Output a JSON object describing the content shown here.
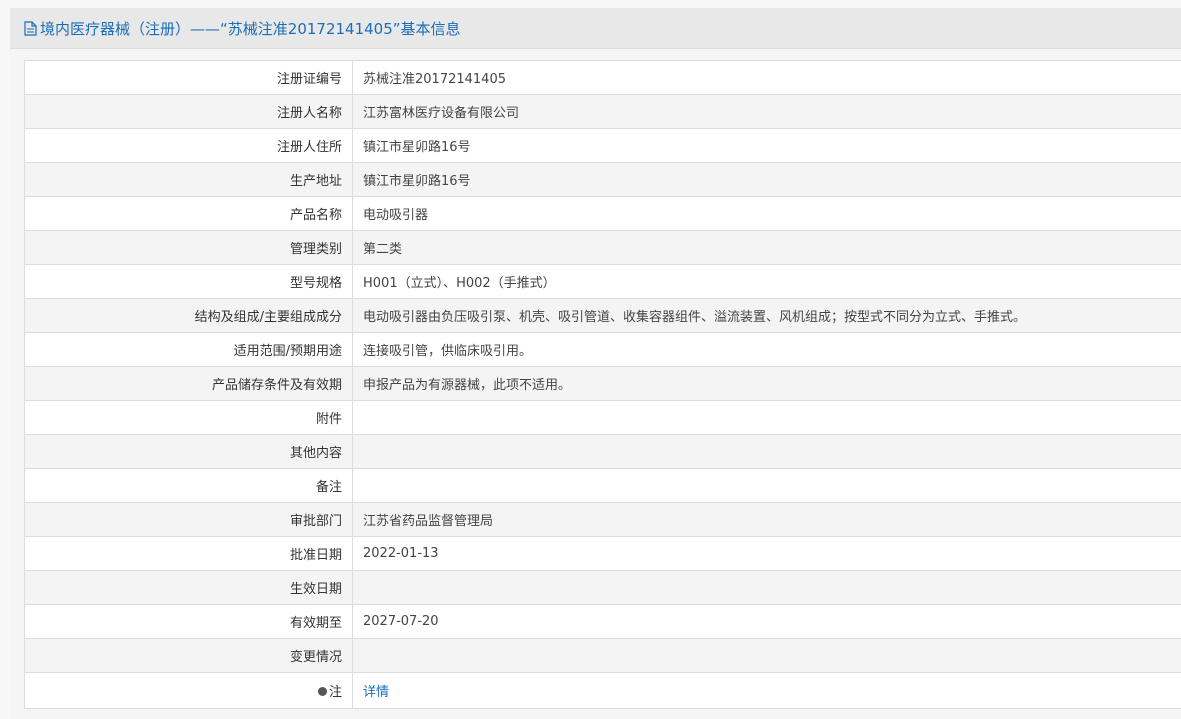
{
  "header": {
    "title": "境内医疗器械（注册）——“苏械注准20172141405”基本信息",
    "icon": "document-icon"
  },
  "rows": [
    {
      "label": "注册证编号",
      "value": "苏械注准20172141405"
    },
    {
      "label": "注册人名称",
      "value": "江苏富林医疗设备有限公司"
    },
    {
      "label": "注册人住所",
      "value": "镇江市星卯路16号"
    },
    {
      "label": "生产地址",
      "value": "镇江市星卯路16号"
    },
    {
      "label": "产品名称",
      "value": "电动吸引器"
    },
    {
      "label": "管理类别",
      "value": "第二类"
    },
    {
      "label": "型号规格",
      "value": "H001（立式）、H002（手推式）"
    },
    {
      "label": "结构及组成/主要组成成分",
      "value": "电动吸引器由负压吸引泵、机壳、吸引管道、收集容器组件、溢流装置、风机组成；按型式不同分为立式、手推式。"
    },
    {
      "label": "适用范围/预期用途",
      "value": "连接吸引管，供临床吸引用。"
    },
    {
      "label": "产品储存条件及有效期",
      "value": "申报产品为有源器械，此项不适用。"
    },
    {
      "label": "附件",
      "value": ""
    },
    {
      "label": "其他内容",
      "value": ""
    },
    {
      "label": "备注",
      "value": ""
    },
    {
      "label": "审批部门",
      "value": "江苏省药品监督管理局"
    },
    {
      "label": "批准日期",
      "value": "2022-01-13"
    },
    {
      "label": "生效日期",
      "value": ""
    },
    {
      "label": "有效期至",
      "value": "2027-07-20"
    },
    {
      "label": "变更情况",
      "value": ""
    }
  ],
  "note": {
    "label": "注",
    "icon": "pin-icon",
    "link_text": "详情"
  },
  "colors": {
    "accent": "#1b6db8",
    "row_alt": "#f4f4f4",
    "border": "#dddddd"
  }
}
